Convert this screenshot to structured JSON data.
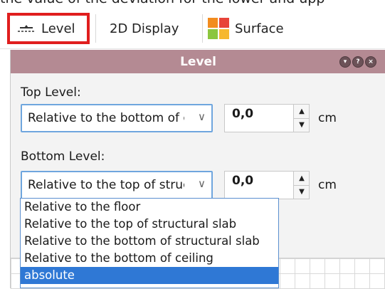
{
  "caption_text": "the value of the deviation for the lower and upp",
  "toolbar": {
    "level_label": "Level",
    "display2d_label": "2D Display",
    "surface_label": "Surface"
  },
  "panel": {
    "title": "Level",
    "window_buttons": [
      "pin-icon",
      "help-icon",
      "close-icon"
    ]
  },
  "top_level": {
    "label": "Top Level:",
    "selected": "Relative to the bottom of ceiling",
    "value": "0,0",
    "unit": "cm"
  },
  "bottom_level": {
    "label": "Bottom Level:",
    "selected": "Relative to the top of structural slab",
    "value": "0,0",
    "unit": "cm"
  },
  "dropdown": {
    "options": [
      "Relative to the floor",
      "Relative to the top of structural slab",
      "Relative to the bottom of structural slab",
      "Relative to the bottom of ceiling",
      "absolute"
    ],
    "highlighted": "absolute"
  },
  "colors": {
    "panel_header": "#b48a93",
    "highlight": "#e01e1e",
    "select_border": "#6fa6de",
    "dropdown_selected": "#2f78d5"
  }
}
